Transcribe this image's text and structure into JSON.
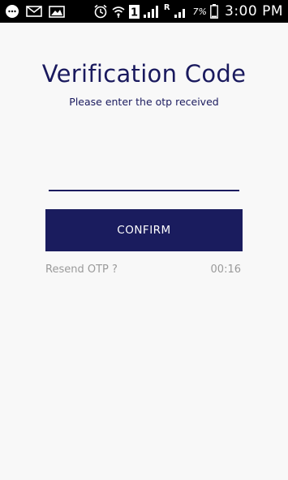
{
  "status_bar": {
    "time": "3:00 PM",
    "battery_percent": "7%",
    "sim_slot": "1",
    "roaming": "R",
    "icons": [
      "messenger-icon",
      "mail-icon",
      "gallery-icon",
      "alarm-icon",
      "wifi-icon",
      "signal-icon",
      "signal-icon",
      "battery-icon"
    ]
  },
  "verification": {
    "title": "Verification Code",
    "subtitle": "Please enter the otp received",
    "otp_value": "",
    "otp_placeholder": "",
    "confirm_label": "CONFIRM",
    "resend_label": "Resend OTP ?",
    "timer": "00:16"
  },
  "colors": {
    "primary": "#1a1c5e",
    "muted_text": "#9a9a9a",
    "background": "#f8f8f8"
  }
}
